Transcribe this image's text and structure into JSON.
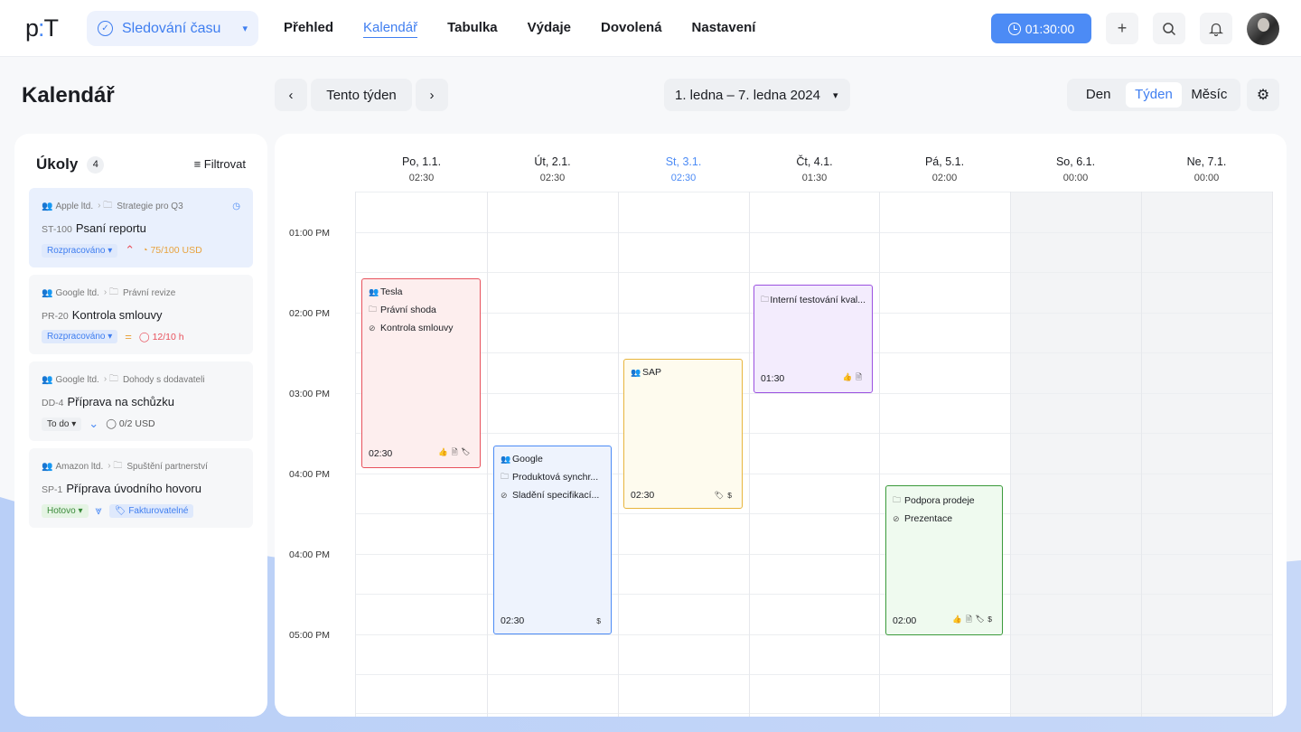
{
  "brand": {
    "logo_p": "p",
    "logo_dot": ":",
    "logo_t": "T"
  },
  "product": {
    "label": "Sledování času"
  },
  "nav": {
    "items": [
      "Přehled",
      "Kalendář",
      "Tabulka",
      "Výdaje",
      "Dovolená",
      "Nastavení"
    ],
    "active": "Kalendář"
  },
  "timer": {
    "value": "01:30:00"
  },
  "page": {
    "title": "Kalendář"
  },
  "toolbar": {
    "this_week": "Tento týden",
    "range": "1. ledna – 7. ledna 2024",
    "views": [
      "Den",
      "Týden",
      "Měsíc"
    ],
    "active_view": "Týden"
  },
  "tasks": {
    "header": "Úkoly",
    "count": "4",
    "filter_label": "Filtrovat",
    "items": [
      {
        "client": "Apple ltd.",
        "project": "Strategie pro Q3",
        "code": "ST-100",
        "title": "Psaní reportu",
        "status": "Rozpracováno",
        "progress": "75/100 USD"
      },
      {
        "client": "Google ltd.",
        "project": "Právní revize",
        "code": "PR-20",
        "title": "Kontrola smlouvy",
        "status": "Rozpracováno",
        "progress": "12/10 h"
      },
      {
        "client": "Google ltd.",
        "project": "Dohody s dodavateli",
        "code": "DD-4",
        "title": "Příprava na schůzku",
        "status": "To do",
        "progress": "0/2 USD"
      },
      {
        "client": "Amazon ltd.",
        "project": "Spuštění partnerství",
        "code": "SP-1",
        "title": "Příprava úvodního hovoru",
        "status": "Hotovo",
        "tag": "Fakturovatelné"
      }
    ]
  },
  "calendar": {
    "days": [
      {
        "label": "Po, 1.1.",
        "total": "02:30"
      },
      {
        "label": "Út, 2.1.",
        "total": "02:30"
      },
      {
        "label": "St, 3.1.",
        "total": "02:30"
      },
      {
        "label": "Čt, 4.1.",
        "total": "01:30"
      },
      {
        "label": "Pá, 5.1.",
        "total": "02:00"
      },
      {
        "label": "So, 6.1.",
        "total": "00:00"
      },
      {
        "label": "Ne, 7.1.",
        "total": "00:00"
      }
    ],
    "time_labels": [
      "01:00 PM",
      "02:00 PM",
      "03:00 PM",
      "04:00 PM",
      "04:00 PM",
      "05:00 PM"
    ],
    "events": [
      {
        "client": "Tesla",
        "project": "Právní shoda",
        "task": "Kontrola smlouvy",
        "duration": "02:30",
        "color": "#e8515c",
        "bg": "#fdeeee"
      },
      {
        "client": "Google",
        "project": "Produktová synchr...",
        "task": "Sladění specifikací...",
        "duration": "02:30",
        "color": "#4c8bf5",
        "bg": "#eef3fd"
      },
      {
        "client": "SAP",
        "duration": "02:30",
        "color": "#e8b53d",
        "bg": "#fefbee"
      },
      {
        "project": "Interní testování kval...",
        "duration": "01:30",
        "color": "#9b51e0",
        "bg": "#f3ecfd"
      },
      {
        "project": "Podpora prodeje",
        "task": "Prezentace",
        "duration": "02:00",
        "color": "#3a9a3a",
        "bg": "#effaef"
      }
    ]
  }
}
